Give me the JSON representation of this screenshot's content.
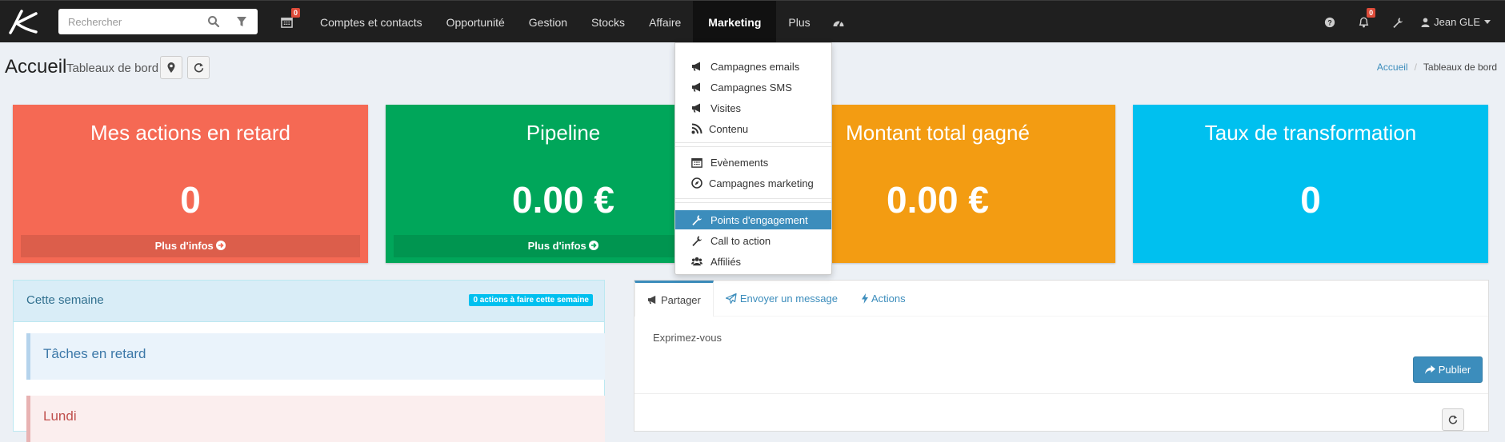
{
  "search": {
    "placeholder": "Rechercher"
  },
  "nav": {
    "calendar_badge": "0",
    "items": [
      "Comptes et contacts",
      "Opportunité",
      "Gestion",
      "Stocks",
      "Affaire",
      "Marketing",
      "Plus"
    ],
    "notif_badge": "0",
    "user": "Jean GLE"
  },
  "header": {
    "title": "Accueil",
    "subtitle": "Tableaux de bord"
  },
  "breadcrumb": {
    "home": "Accueil",
    "current": "Tableaux de bord"
  },
  "tiles": [
    {
      "title": "Mes actions en retard",
      "value": "0",
      "footer": "Plus d'infos",
      "color": "#f56954"
    },
    {
      "title": "Pipeline",
      "value": "0.00 €",
      "footer": "Plus d'infos",
      "color": "#00a65a"
    },
    {
      "title": "Montant total gagné",
      "value": "0.00 €",
      "color": "#f39c12"
    },
    {
      "title": "Taux de transformation",
      "value": "0",
      "color": "#00c0ef"
    }
  ],
  "week": {
    "title": "Cette semaine",
    "badge": "0 actions à faire cette semaine",
    "late_tasks": "Tâches en retard",
    "monday": "Lundi"
  },
  "share": {
    "tabs": [
      "Partager",
      "Envoyer un message",
      "Actions"
    ],
    "prompt": "Exprimez-vous",
    "publish": "Publier"
  },
  "marketing_menu": {
    "items": [
      {
        "label": "Campagnes emails",
        "icon": "bullhorn-icon"
      },
      {
        "label": "Campagnes SMS",
        "icon": "bullhorn-icon"
      },
      {
        "label": "Visites",
        "icon": "bullhorn-icon"
      },
      {
        "label": "Contenu",
        "icon": "rss-icon"
      },
      {
        "label": "Evènements",
        "icon": "calendar-icon"
      },
      {
        "label": "Campagnes marketing",
        "icon": "compass-icon"
      },
      {
        "label": "Points d'engagement",
        "icon": "wrench-icon"
      },
      {
        "label": "Call to action",
        "icon": "wrench-icon"
      },
      {
        "label": "Affiliés",
        "icon": "users-icon"
      }
    ],
    "active": "Points d'engagement"
  },
  "colors": {
    "navbar": "#1f1f1f",
    "accent": "#3c8dbc",
    "badge": "#dd4b39"
  }
}
